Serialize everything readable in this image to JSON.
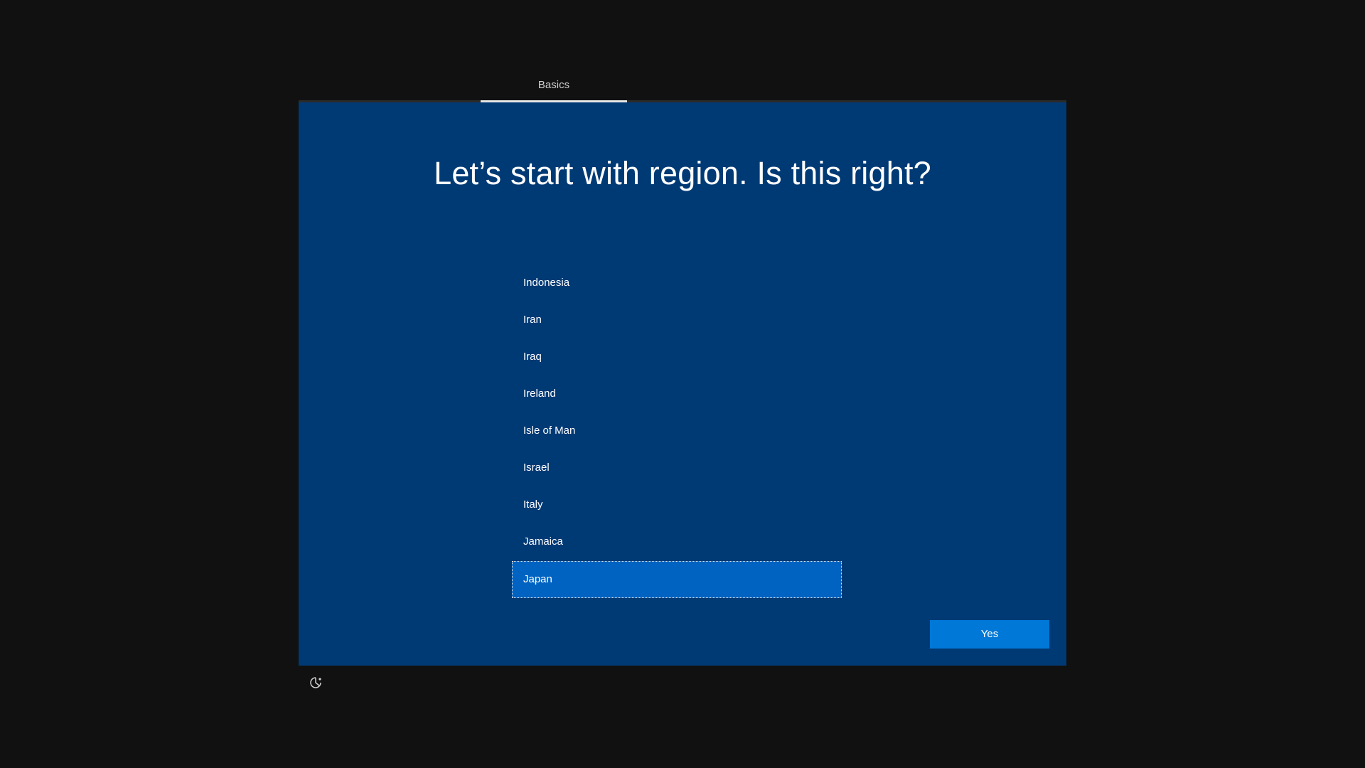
{
  "tabs": {
    "active_label": "Basics"
  },
  "page": {
    "title": "Let’s start with region. Is this right?"
  },
  "region_list": {
    "items": [
      {
        "label": "Indonesia",
        "selected": false
      },
      {
        "label": "Iran",
        "selected": false
      },
      {
        "label": "Iraq",
        "selected": false
      },
      {
        "label": "Ireland",
        "selected": false
      },
      {
        "label": "Isle of Man",
        "selected": false
      },
      {
        "label": "Israel",
        "selected": false
      },
      {
        "label": "Italy",
        "selected": false
      },
      {
        "label": "Jamaica",
        "selected": false
      },
      {
        "label": "Japan",
        "selected": true
      }
    ],
    "scroll_up_icon": "chevron-up-icon",
    "scroll_down_icon": "chevron-down-icon"
  },
  "actions": {
    "yes_label": "Yes"
  },
  "footer": {
    "accessibility_icon": "ease-of-access-icon"
  },
  "colors": {
    "background": "#111111",
    "panel": "#003a75",
    "selected_item": "#0063c2",
    "primary_button": "#0078d7"
  }
}
